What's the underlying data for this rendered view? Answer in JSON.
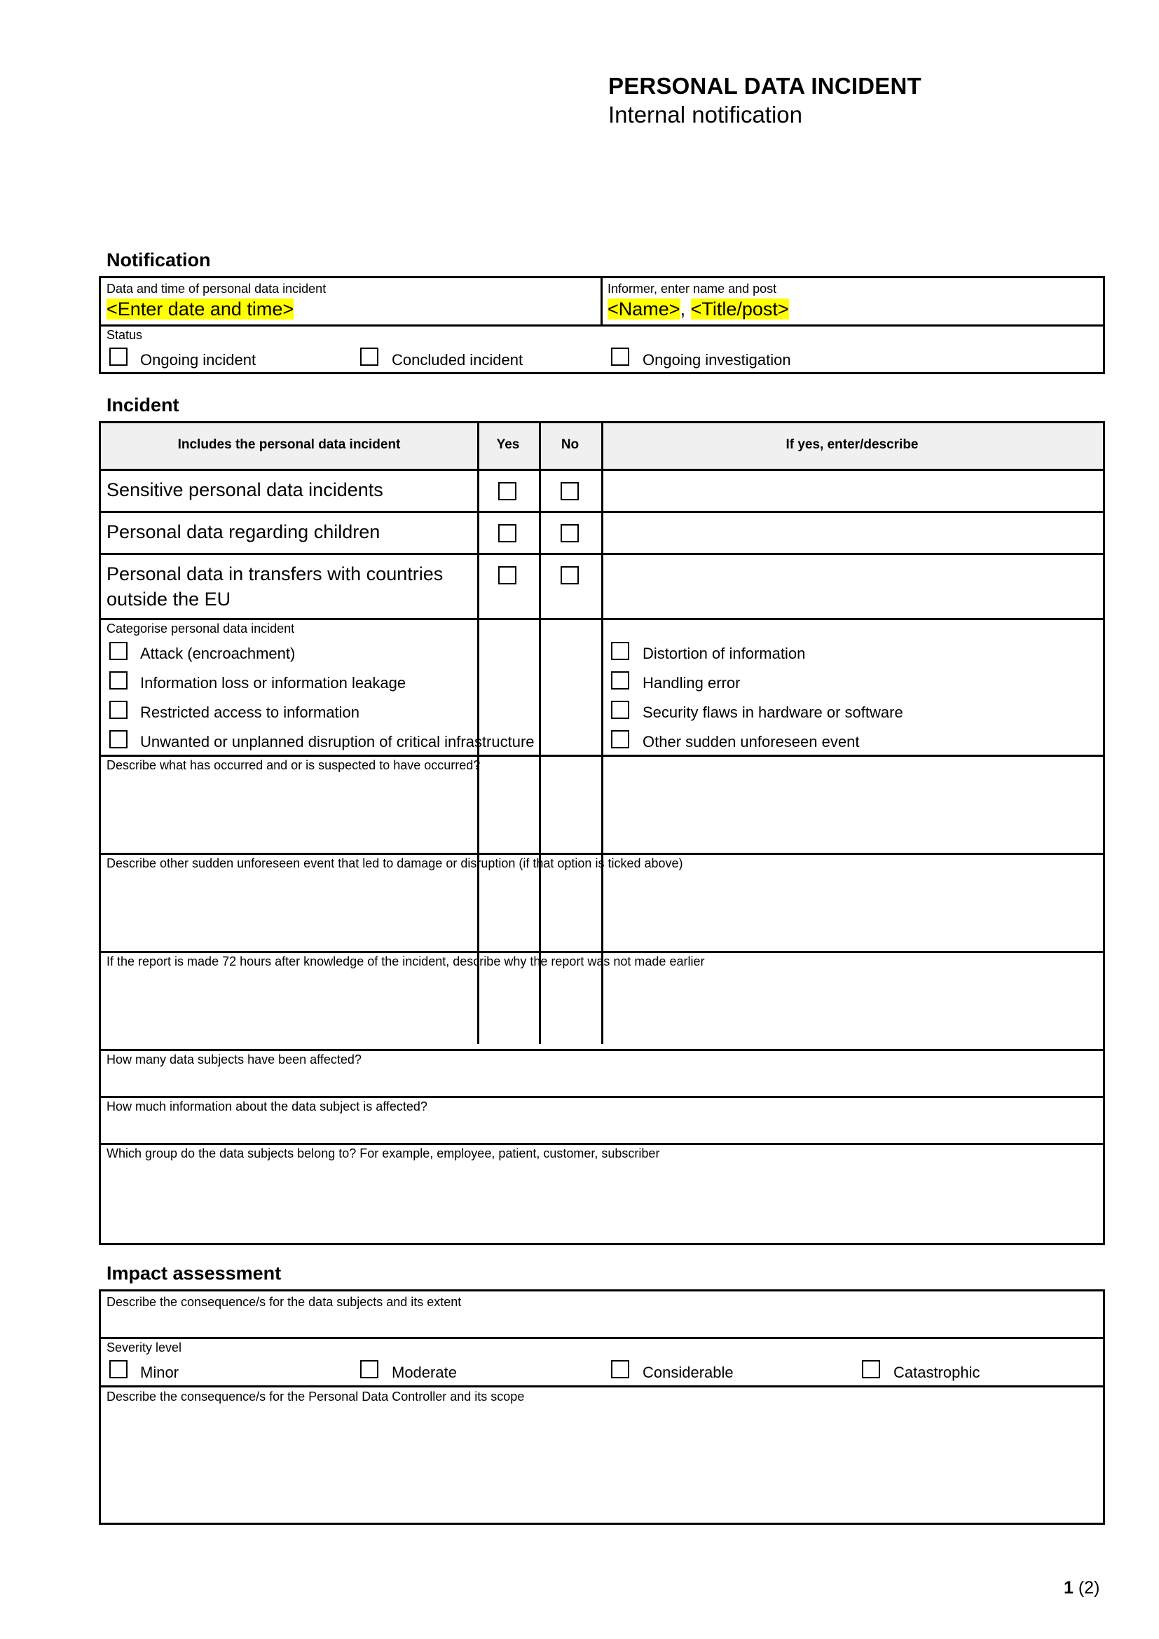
{
  "header": {
    "title": "PERSONAL DATA INCIDENT",
    "subtitle": "Internal notification"
  },
  "notification": {
    "heading": "Notification",
    "date_label": "Data and time of personal data incident",
    "date_value": "<Enter date and time>",
    "informer_label": "Informer, enter name and post",
    "informer_name": "<Name>",
    "informer_separator": ",",
    "informer_title": "<Title/post>",
    "status_label": "Status",
    "status_options": [
      "Ongoing incident",
      "Concluded incident",
      "Ongoing investigation"
    ]
  },
  "incident": {
    "heading": "Incident",
    "table": {
      "headers": [
        "Includes the personal data incident",
        "Yes",
        "No",
        "If yes, enter/describe"
      ],
      "rows": [
        {
          "label": "Sensitive personal data incidents"
        },
        {
          "label": "Personal data regarding children"
        },
        {
          "label_line1": "Personal data in transfers with countries",
          "label_line2": "outside the EU"
        }
      ]
    },
    "categorise_label": "Categorise personal data incident",
    "categories_left": [
      "Attack (encroachment)",
      "Information loss or information leakage",
      "Restricted access to information",
      "Unwanted or unplanned disruption of critical infrastructure"
    ],
    "categories_right": [
      "Distortion of information",
      "Handling error",
      "Security flaws in hardware or software",
      "Other sudden unforeseen event"
    ],
    "questions": [
      "Describe what has occurred and or is suspected to have occurred?",
      "Describe other sudden unforeseen event that led to damage or disruption (if that option is ticked above)",
      "If the report is made 72 hours after knowledge of the incident, describe why the report was not made earlier",
      "How many data subjects have been affected?",
      "How much information about the data subject is affected?",
      "Which group do the data subjects belong to? For example, employee, patient, customer, subscriber"
    ]
  },
  "impact": {
    "heading": "Impact assessment",
    "consequence_subjects_label": "Describe the consequence/s for the data subjects and its extent",
    "severity_label": "Severity level",
    "severity_options": [
      "Minor",
      "Moderate",
      "Considerable",
      "Catastrophic"
    ],
    "consequence_controller_label": "Describe the consequence/s for the Personal Data Controller and its scope"
  },
  "footer": {
    "page_current": "1",
    "page_total": "(2)"
  },
  "colors": {
    "placeholder_highlight": "#ffff00",
    "table_header_bg": "#f0f0f0"
  }
}
